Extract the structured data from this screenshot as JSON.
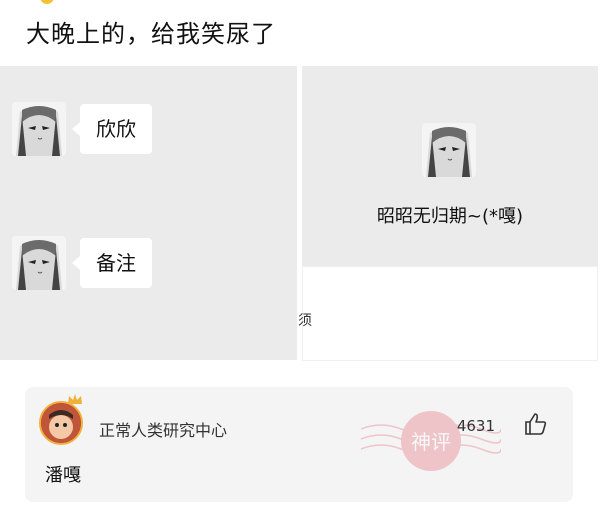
{
  "post": {
    "title": "大晚上的，给我笑尿了"
  },
  "chat": {
    "messages": [
      {
        "text": "欣欣"
      },
      {
        "text": "备注"
      }
    ]
  },
  "contact_card": {
    "name": "昭昭无归期~(*嘎)"
  },
  "stray_char": "须",
  "comment": {
    "username": "正常人类研究中心",
    "likes": "4631",
    "text": "潘嘎",
    "badge_text": "神评",
    "badge_icon": "stamp-badge-icon"
  },
  "colors": {
    "panel_bg": "#ebebeb",
    "card_bg": "#f4f4f4",
    "stamp": "#e36d7a"
  }
}
